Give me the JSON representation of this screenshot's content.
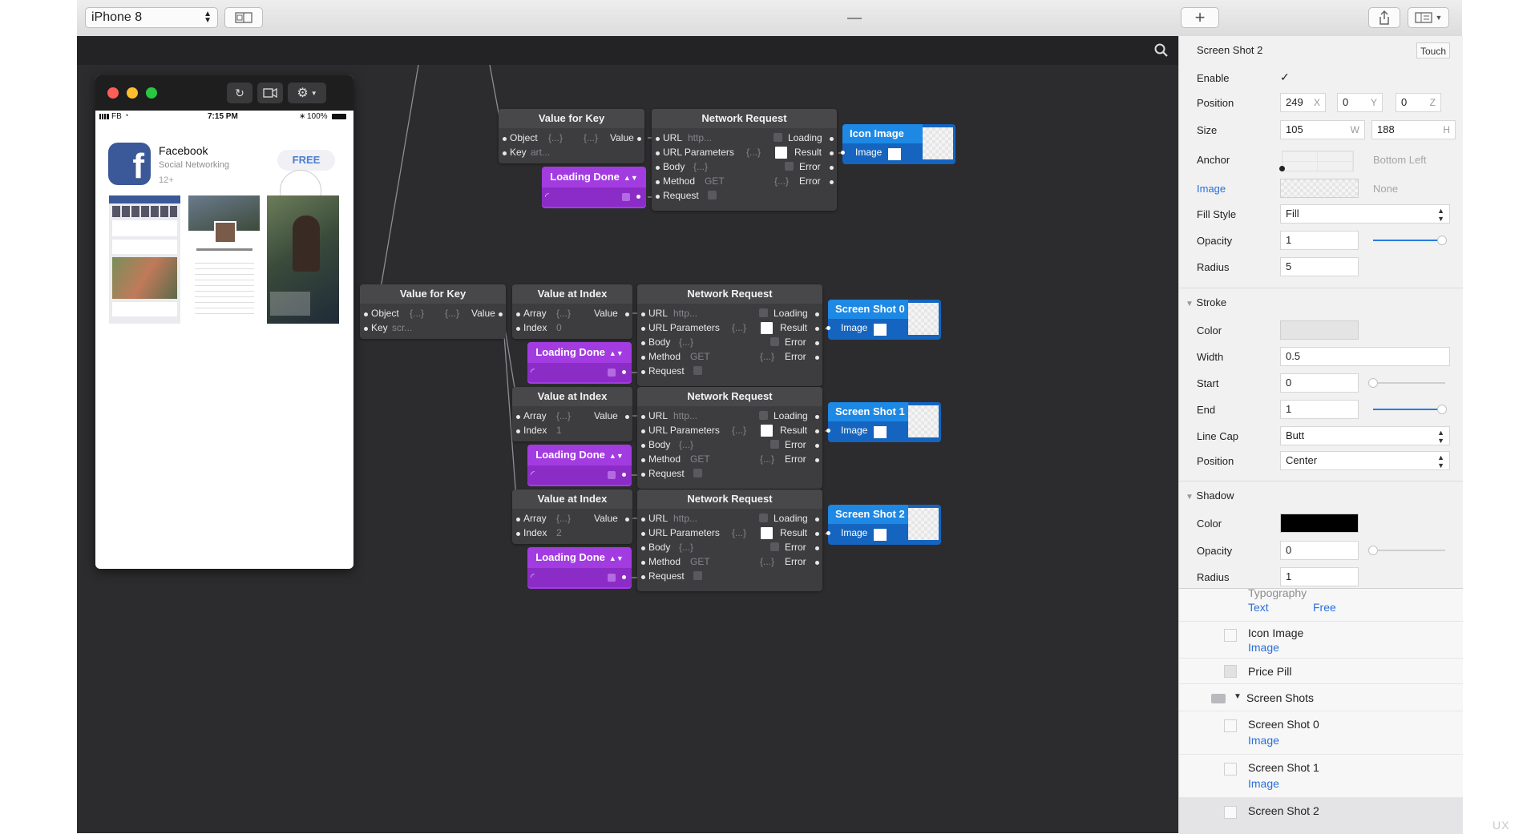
{
  "toolbar": {
    "device": "iPhone 8"
  },
  "preview": {
    "status_carrier": "FB",
    "status_time": "7:15 PM",
    "status_battery": "100%",
    "app_name": "Facebook",
    "app_category": "Social Networking",
    "app_rating": "12+",
    "price_label": "FREE"
  },
  "graph": {
    "top": {
      "vfk": {
        "title": "Value for Key",
        "object": "Object",
        "object_val": "{...}",
        "value_val": "{...}",
        "value": "Value",
        "key": "Key",
        "key_val": "art..."
      },
      "net": {
        "title": "Network Request",
        "url": "URL",
        "url_val": "http...",
        "params": "URL Parameters",
        "params_val": "{...}",
        "body": "Body",
        "body_val": "{...}",
        "method": "Method",
        "method_val": "GET",
        "request": "Request",
        "loading": "Loading",
        "result": "Result",
        "error": "Error",
        "error2_val": "{...}",
        "error2": "Error"
      },
      "loading": "Loading Done",
      "image": {
        "title": "Icon Image",
        "port": "Image"
      }
    },
    "vfk2": {
      "title": "Value for Key",
      "object": "Object",
      "object_val": "{...}",
      "value_val": "{...}",
      "value": "Value",
      "key": "Key",
      "key_val": "scr..."
    },
    "rows": [
      {
        "via": {
          "title": "Value at Index",
          "array": "Array",
          "array_val": "{...}",
          "value": "Value",
          "index": "Index",
          "index_val": "0"
        },
        "loading": "Loading Done",
        "net": {
          "title": "Network Request",
          "url": "URL",
          "url_val": "http...",
          "params": "URL Parameters",
          "params_val": "{...}",
          "body": "Body",
          "body_val": "{...}",
          "method": "Method",
          "method_val": "GET",
          "request": "Request",
          "loading": "Loading",
          "result": "Result",
          "error": "Error",
          "error2_val": "{...}",
          "error2": "Error"
        },
        "image": {
          "title": "Screen Shot 0",
          "port": "Image"
        }
      },
      {
        "via": {
          "title": "Value at Index",
          "array": "Array",
          "array_val": "{...}",
          "value": "Value",
          "index": "Index",
          "index_val": "1"
        },
        "loading": "Loading Done",
        "net": {
          "title": "Network Request",
          "url": "URL",
          "url_val": "http...",
          "params": "URL Parameters",
          "params_val": "{...}",
          "body": "Body",
          "body_val": "{...}",
          "method": "Method",
          "method_val": "GET",
          "request": "Request",
          "loading": "Loading",
          "result": "Result",
          "error": "Error",
          "error2_val": "{...}",
          "error2": "Error"
        },
        "image": {
          "title": "Screen Shot 1",
          "port": "Image"
        }
      },
      {
        "via": {
          "title": "Value at Index",
          "array": "Array",
          "array_val": "{...}",
          "value": "Value",
          "index": "Index",
          "index_val": "2"
        },
        "loading": "Loading Done",
        "net": {
          "title": "Network Request",
          "url": "URL",
          "url_val": "http...",
          "params": "URL Parameters",
          "params_val": "{...}",
          "body": "Body",
          "body_val": "{...}",
          "method": "Method",
          "method_val": "GET",
          "request": "Request",
          "loading": "Loading",
          "result": "Result",
          "error": "Error",
          "error2_val": "{...}",
          "error2": "Error"
        },
        "image": {
          "title": "Screen Shot 2",
          "port": "Image"
        }
      }
    ]
  },
  "inspector": {
    "layer_name": "Screen Shot 2",
    "touch_label": "Touch",
    "enable": "Enable",
    "enable_check": "✓",
    "position": "Position",
    "pos_x": "249",
    "pos_x_s": "X",
    "pos_y": "0",
    "pos_y_s": "Y",
    "pos_z": "0",
    "pos_z_s": "Z",
    "size": "Size",
    "size_w": "105",
    "size_w_s": "W",
    "size_h": "188",
    "size_h_s": "H",
    "anchor": "Anchor",
    "anchor_val": "Bottom Left",
    "image": "Image",
    "image_val": "None",
    "fill_style": "Fill Style",
    "fill_style_val": "Fill",
    "opacity": "Opacity",
    "opacity_val": "1",
    "opacity_level": 0.95,
    "radius": "Radius",
    "radius_val": "5",
    "stroke": {
      "header": "Stroke",
      "color": "Color",
      "color_hex": "#e4e4e4",
      "width": "Width",
      "width_val": "0.5",
      "start": "Start",
      "start_val": "0",
      "start_level": 0.0,
      "end": "End",
      "end_val": "1",
      "end_level": 0.95,
      "line_cap": "Line Cap",
      "line_cap_val": "Butt",
      "position": "Position",
      "position_val": "Center"
    },
    "shadow": {
      "header": "Shadow",
      "color": "Color",
      "color_hex": "#000000",
      "opacity": "Opacity",
      "opacity_val": "0",
      "opacity_level": 0.0,
      "radius": "Radius",
      "radius_val": "1"
    }
  },
  "layers": {
    "typography": "Typography",
    "typo_text": "Text",
    "typo_free": "Free",
    "items": [
      {
        "name": "Icon Image",
        "sub": "Image"
      },
      {
        "name": "Price Pill"
      },
      {
        "name": "Screen Shots"
      },
      {
        "name": "Screen Shot 0",
        "sub": "Image"
      },
      {
        "name": "Screen Shot 1",
        "sub": "Image"
      },
      {
        "name": "Screen Shot 2"
      }
    ]
  },
  "watermark": "UX"
}
